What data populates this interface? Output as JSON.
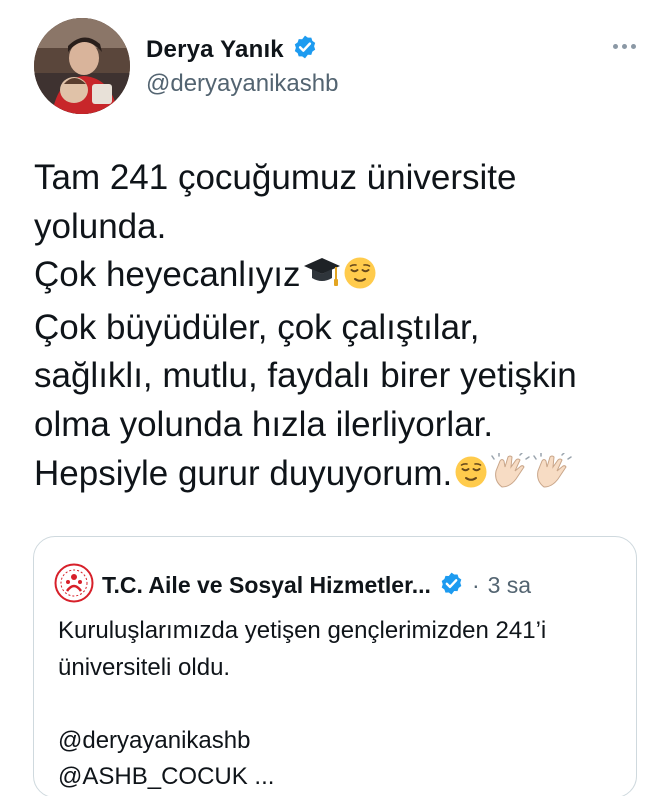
{
  "author": {
    "display_name": "Derya Yanık",
    "handle": "@deryayanikashb",
    "verified": true
  },
  "tweet": {
    "lines": [
      "Tam 241 çocuğumuz üniversite",
      "yolunda.",
      "Çok heyecanlıyız",
      "Çok büyüdüler, çok çalıştılar,",
      "sağlıklı, mutlu, faydalı birer yetişkin",
      "olma yolunda hızla ilerliyorlar.",
      "Hepsiyle gurur duyuyorum."
    ]
  },
  "quoted_tweet": {
    "author_name": "T.C. Aile ve Sosyal Hizmetler...",
    "separator": "·",
    "time": "3 sa",
    "verified": true,
    "lines": [
      "Kuruluşlarımızda yetişen gençlerimizden 241’i",
      "üniversiteli oldu.",
      "",
      "@deryayanikashb",
      "@ASHB_COCUK ..."
    ]
  },
  "colors": {
    "text_primary": "#0f1419",
    "text_secondary": "#536471",
    "verified_blue": "#1d9bf0",
    "border": "#cfd9de",
    "ministry_red": "#d7202a"
  },
  "icons": {
    "verified": "verified-badge-icon",
    "more": "more-dots-icon",
    "graduation_cap": "graduation-cap-emoji",
    "relieved_face": "relieved-face-emoji",
    "clapping_hands": "clapping-hands-emoji",
    "ministry_logo": "ministry-logo-icon"
  }
}
